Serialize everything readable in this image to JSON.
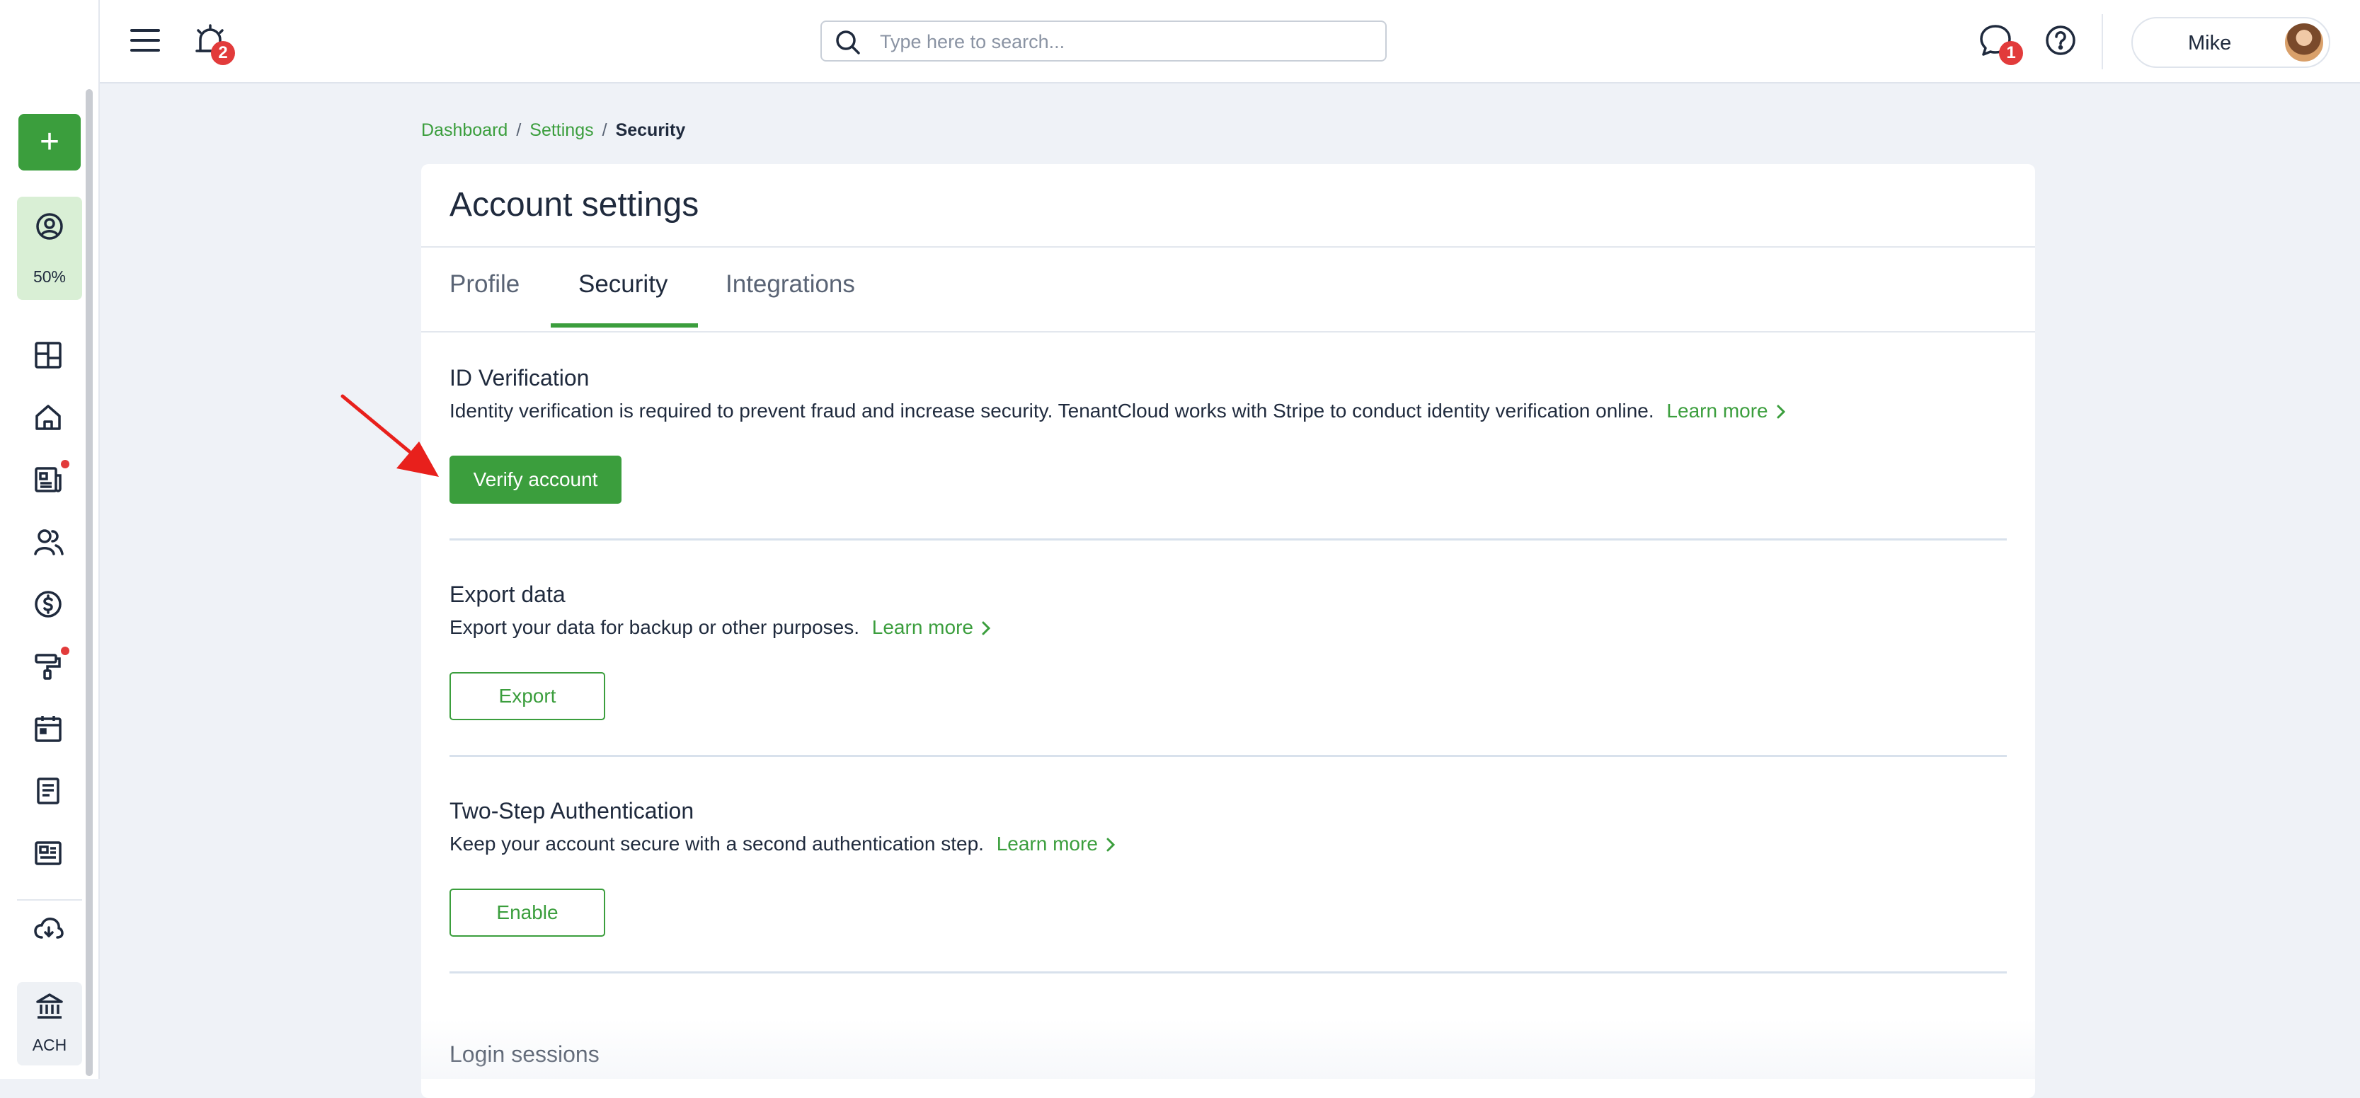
{
  "header": {
    "notifications_badge": "2",
    "messages_badge": "1",
    "icons": {
      "menu": "hamburger-menu-icon",
      "alarm": "alarm-clock-icon",
      "chat": "chat-bubble-icon",
      "help": "question-circle-icon"
    }
  },
  "search": {
    "placeholder": "Type here to search...",
    "value": ""
  },
  "user": {
    "name": "Mike"
  },
  "sidebar": {
    "add_label": "+",
    "progress_percent": "50%",
    "ach_label": "ACH",
    "items": [
      {
        "icon": "dashboard-grid-icon"
      },
      {
        "icon": "home-icon"
      },
      {
        "icon": "newspaper-icon",
        "dot": true
      },
      {
        "icon": "users-icon"
      },
      {
        "icon": "dollar-circle-icon"
      },
      {
        "icon": "paint-roller-icon",
        "dot": true
      },
      {
        "icon": "calendar-icon"
      },
      {
        "icon": "document-icon"
      },
      {
        "icon": "listing-card-icon"
      },
      {
        "icon": "cloud-download-icon"
      }
    ]
  },
  "breadcrumb": {
    "items": [
      "Dashboard",
      "Settings"
    ],
    "current": "Security"
  },
  "page": {
    "title": "Account settings",
    "tabs": [
      {
        "label": "Profile",
        "active": false
      },
      {
        "label": "Security",
        "active": true
      },
      {
        "label": "Integrations",
        "active": false
      }
    ]
  },
  "sections": {
    "id_verification": {
      "title": "ID Verification",
      "description": "Identity verification is required to prevent fraud and increase security. TenantCloud works with Stripe to conduct identity verification online.",
      "learn_more": "Learn more",
      "button": "Verify account"
    },
    "export_data": {
      "title": "Export data",
      "description": "Export your data for backup or other purposes.",
      "learn_more": "Learn more",
      "button": "Export"
    },
    "two_step": {
      "title": "Two-Step Authentication",
      "description": "Keep your account secure with a second authentication step.",
      "learn_more": "Learn more",
      "button": "Enable"
    },
    "login_sessions": {
      "title": "Login sessions"
    }
  },
  "colors": {
    "accent_green": "#3b9e3d",
    "badge_red": "#e23b3b",
    "background": "#eff2f7",
    "text_dark": "#1f2a3d",
    "annotation_arrow": "#e8201c"
  }
}
